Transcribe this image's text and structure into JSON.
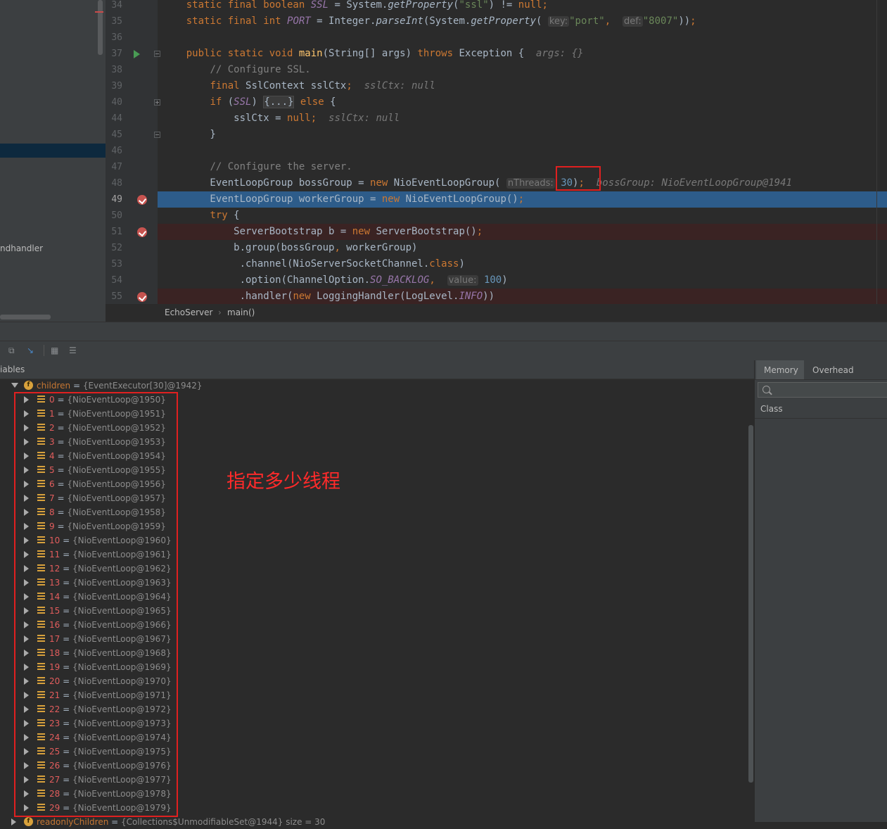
{
  "project": {
    "tree_label": "ndhandler"
  },
  "editor": {
    "lines": [
      {
        "n": "34",
        "parts": [
          {
            "t": "    "
          },
          {
            "t": "static final boolean ",
            "c": "kw"
          },
          {
            "t": "SSL",
            "c": "sf"
          },
          {
            "t": " = System."
          },
          {
            "t": "getProperty",
            "c": "it"
          },
          {
            "t": "("
          },
          {
            "t": "\"ssl\"",
            "c": "st"
          },
          {
            "t": ") != "
          },
          {
            "t": "null",
            "c": "kw"
          },
          {
            "t": ";",
            "c": "kw"
          }
        ]
      },
      {
        "n": "35",
        "parts": [
          {
            "t": "    "
          },
          {
            "t": "static final int ",
            "c": "kw"
          },
          {
            "t": "PORT",
            "c": "sf"
          },
          {
            "t": " = Integer."
          },
          {
            "t": "parseInt",
            "c": "it"
          },
          {
            "t": "(System."
          },
          {
            "t": "getProperty",
            "c": "it"
          },
          {
            "t": "( "
          },
          {
            "t": "key:",
            "c": "ih"
          },
          {
            "t": "\"port\"",
            "c": "st"
          },
          {
            "t": ", ",
            "c": "kw"
          },
          {
            "t": " "
          },
          {
            "t": "def:",
            "c": "ih"
          },
          {
            "t": "\"8007\"",
            "c": "st"
          },
          {
            "t": "))"
          },
          {
            "t": ";",
            "c": "kw"
          }
        ]
      },
      {
        "n": "36",
        "parts": []
      },
      {
        "n": "37",
        "parts": [
          {
            "t": "    "
          },
          {
            "t": "public static void ",
            "c": "kw"
          },
          {
            "t": "main",
            "c": "fn"
          },
          {
            "t": "(String[] args) "
          },
          {
            "t": "throws",
            "c": "kw"
          },
          {
            "t": " Exception {  "
          },
          {
            "t": "args: {}",
            "c": "iv"
          }
        ]
      },
      {
        "n": "38",
        "parts": [
          {
            "t": "        "
          },
          {
            "t": "// Configure SSL.",
            "c": "cm"
          }
        ]
      },
      {
        "n": "39",
        "parts": [
          {
            "t": "        "
          },
          {
            "t": "final ",
            "c": "kw"
          },
          {
            "t": "SslContext sslCtx"
          },
          {
            "t": ";",
            "c": "kw"
          },
          {
            "t": "  "
          },
          {
            "t": "sslCtx: null",
            "c": "iv"
          }
        ]
      },
      {
        "n": "40",
        "parts": [
          {
            "t": "        "
          },
          {
            "t": "if ",
            "c": "kw"
          },
          {
            "t": "("
          },
          {
            "t": "SSL",
            "c": "sf"
          },
          {
            "t": ") "
          },
          {
            "t": "{...}",
            "c": "foldbox"
          },
          {
            "t": " "
          },
          {
            "t": "else",
            "c": "kw"
          },
          {
            "t": " {"
          }
        ]
      },
      {
        "n": "44",
        "parts": [
          {
            "t": "            sslCtx = "
          },
          {
            "t": "null",
            "c": "kw"
          },
          {
            "t": ";",
            "c": "kw"
          },
          {
            "t": "  "
          },
          {
            "t": "sslCtx: null",
            "c": "iv"
          }
        ]
      },
      {
        "n": "45",
        "parts": [
          {
            "t": "        }"
          }
        ]
      },
      {
        "n": "46",
        "parts": []
      },
      {
        "n": "47",
        "parts": [
          {
            "t": "        "
          },
          {
            "t": "// Configure the server.",
            "c": "cm"
          }
        ]
      },
      {
        "n": "48",
        "parts": [
          {
            "t": "        EventLoopGroup bossGroup = "
          },
          {
            "t": "new ",
            "c": "kw"
          },
          {
            "t": "NioEventLoopGroup( "
          },
          {
            "t": "nThreads:",
            "c": "ih"
          },
          {
            "t": " "
          },
          {
            "t": "30",
            "c": "nm"
          },
          {
            "t": ")"
          },
          {
            "t": ";",
            "c": "kw"
          },
          {
            "t": "  "
          },
          {
            "t": "bossGroup: NioEventLoopGroup@1941",
            "c": "iv"
          }
        ]
      },
      {
        "n": "49",
        "parts": [
          {
            "t": "        EventLoopGroup workerGroup = "
          },
          {
            "t": "new ",
            "c": "kw"
          },
          {
            "t": "NioEventLoopGroup()"
          },
          {
            "t": ";",
            "c": "kw"
          }
        ]
      },
      {
        "n": "50",
        "parts": [
          {
            "t": "        "
          },
          {
            "t": "try",
            "c": "kw"
          },
          {
            "t": " {"
          }
        ]
      },
      {
        "n": "51",
        "parts": [
          {
            "t": "            ServerBootstrap b = "
          },
          {
            "t": "new ",
            "c": "kw"
          },
          {
            "t": "ServerBootstrap()"
          },
          {
            "t": ";",
            "c": "kw"
          }
        ]
      },
      {
        "n": "52",
        "parts": [
          {
            "t": "            b.group(bossGroup"
          },
          {
            "t": ", ",
            "c": "kw"
          },
          {
            "t": "workerGroup)"
          }
        ]
      },
      {
        "n": "53",
        "parts": [
          {
            "t": "             .channel(NioServerSocketChannel."
          },
          {
            "t": "class",
            "c": "kw"
          },
          {
            "t": ")"
          }
        ]
      },
      {
        "n": "54",
        "parts": [
          {
            "t": "             .option(ChannelOption."
          },
          {
            "t": "SO_BACKLOG",
            "c": "sf"
          },
          {
            "t": ", ",
            "c": "kw"
          },
          {
            "t": " "
          },
          {
            "t": "value:",
            "c": "ih"
          },
          {
            "t": " "
          },
          {
            "t": "100",
            "c": "nm"
          },
          {
            "t": ")"
          }
        ]
      },
      {
        "n": "55",
        "parts": [
          {
            "t": "             .handler("
          },
          {
            "t": "new ",
            "c": "kw"
          },
          {
            "t": "LoggingHandler(LogLevel."
          },
          {
            "t": "INFO",
            "c": "sf"
          },
          {
            "t": "))"
          }
        ]
      }
    ],
    "current_line": "49",
    "breakpoint_lines": [
      "49",
      "51",
      "55"
    ],
    "run_line": "37"
  },
  "breadcrumb": {
    "class_name": "EchoServer",
    "sep": "›",
    "method_name": "main()"
  },
  "toolbar": {
    "icon_restore": "restore-layout-icon",
    "icon_step": "step-icon",
    "icon_table": "table-icon",
    "icon_settings": "settings-icon"
  },
  "variables": {
    "title": "iables",
    "root": {
      "name": "children",
      "eq": " = ",
      "value": "{EventExecutor[30]@1942}"
    },
    "items": [
      {
        "i": "0",
        "v": "{NioEventLoop@1950}"
      },
      {
        "i": "1",
        "v": "{NioEventLoop@1951}"
      },
      {
        "i": "2",
        "v": "{NioEventLoop@1952}"
      },
      {
        "i": "3",
        "v": "{NioEventLoop@1953}"
      },
      {
        "i": "4",
        "v": "{NioEventLoop@1954}"
      },
      {
        "i": "5",
        "v": "{NioEventLoop@1955}"
      },
      {
        "i": "6",
        "v": "{NioEventLoop@1956}"
      },
      {
        "i": "7",
        "v": "{NioEventLoop@1957}"
      },
      {
        "i": "8",
        "v": "{NioEventLoop@1958}"
      },
      {
        "i": "9",
        "v": "{NioEventLoop@1959}"
      },
      {
        "i": "10",
        "v": "{NioEventLoop@1960}"
      },
      {
        "i": "11",
        "v": "{NioEventLoop@1961}"
      },
      {
        "i": "12",
        "v": "{NioEventLoop@1962}"
      },
      {
        "i": "13",
        "v": "{NioEventLoop@1963}"
      },
      {
        "i": "14",
        "v": "{NioEventLoop@1964}"
      },
      {
        "i": "15",
        "v": "{NioEventLoop@1965}"
      },
      {
        "i": "16",
        "v": "{NioEventLoop@1966}"
      },
      {
        "i": "17",
        "v": "{NioEventLoop@1967}"
      },
      {
        "i": "18",
        "v": "{NioEventLoop@1968}"
      },
      {
        "i": "19",
        "v": "{NioEventLoop@1969}"
      },
      {
        "i": "20",
        "v": "{NioEventLoop@1970}"
      },
      {
        "i": "21",
        "v": "{NioEventLoop@1971}"
      },
      {
        "i": "22",
        "v": "{NioEventLoop@1972}"
      },
      {
        "i": "23",
        "v": "{NioEventLoop@1973}"
      },
      {
        "i": "24",
        "v": "{NioEventLoop@1974}"
      },
      {
        "i": "25",
        "v": "{NioEventLoop@1975}"
      },
      {
        "i": "26",
        "v": "{NioEventLoop@1976}"
      },
      {
        "i": "27",
        "v": "{NioEventLoop@1977}"
      },
      {
        "i": "28",
        "v": "{NioEventLoop@1978}"
      },
      {
        "i": "29",
        "v": "{NioEventLoop@1979}"
      }
    ],
    "tail": {
      "name": "readonlyChildren",
      "eq": " = ",
      "value": "{Collections$UnmodifiableSet@1944}  size = 30"
    }
  },
  "annotation": {
    "text": "指定多少线程",
    "color": "#ff2a2a"
  },
  "memory": {
    "tab_memory": "Memory",
    "tab_overhead": "Overhead",
    "search_placeholder": "",
    "class_header": "Class"
  },
  "colors": {
    "exec_line": "#2d5c8a",
    "breakpoint": "#c75450",
    "keyword": "#cc7832",
    "string": "#6a8759",
    "number": "#6897bb",
    "highlight_box": "#e02020"
  }
}
